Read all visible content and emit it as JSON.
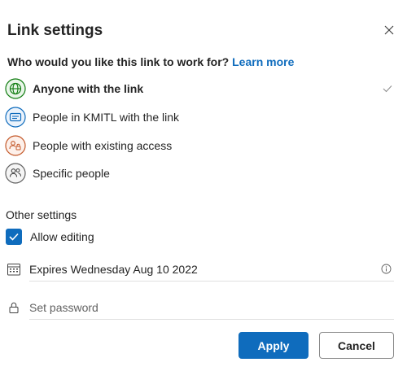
{
  "dialog": {
    "title": "Link settings",
    "close_icon": "close-icon"
  },
  "question": {
    "text": "Who would you like this link to work for?",
    "link": "Learn more"
  },
  "options": [
    {
      "label": "Anyone with the link",
      "icon": "globe-icon",
      "icon_color": "#107c10",
      "selected": true
    },
    {
      "label": "People in KMITL with the link",
      "icon": "building-icon",
      "icon_color": "#0f6cbd",
      "selected": false
    },
    {
      "label": "People with existing access",
      "icon": "people-lock-icon",
      "icon_color": "#c4592a",
      "selected": false
    },
    {
      "label": "Specific people",
      "icon": "people-icon",
      "icon_color": "#616161",
      "selected": false
    }
  ],
  "other_settings": {
    "heading": "Other settings",
    "allow_editing": {
      "label": "Allow editing",
      "checked": true
    },
    "expires": {
      "value": "Expires Wednesday Aug 10 2022",
      "icon": "calendar-icon",
      "info_icon": "info-icon"
    },
    "password": {
      "placeholder": "Set password",
      "icon": "lock-icon"
    }
  },
  "buttons": {
    "apply": "Apply",
    "cancel": "Cancel"
  },
  "colors": {
    "accent": "#0f6cbd",
    "text": "#242424"
  }
}
